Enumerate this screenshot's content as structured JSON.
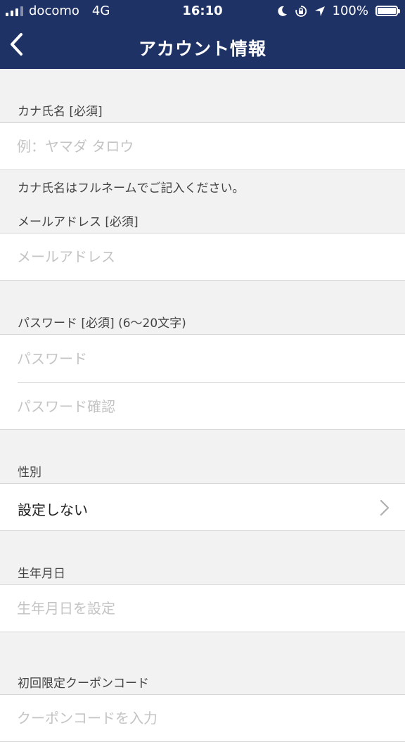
{
  "status_bar": {
    "carrier": "docomo",
    "network": "4G",
    "time": "16:10",
    "battery_text": "100%",
    "battery_level": 1.0
  },
  "nav": {
    "title": "アカウント情報",
    "back_icon": "chevron-left-icon"
  },
  "form": {
    "kana_name": {
      "label": "カナ氏名 [必須]",
      "placeholder": "例：ヤマダ タロウ",
      "hint": "カナ氏名はフルネームでご記入ください。"
    },
    "email": {
      "label": "メールアドレス [必須]",
      "placeholder": "メールアドレス"
    },
    "password": {
      "label": "パスワード [必須] (6〜20文字)",
      "placeholder": "パスワード",
      "confirm_placeholder": "パスワード確認"
    },
    "gender": {
      "label": "性別",
      "value": "設定しない"
    },
    "birthday": {
      "label": "生年月日",
      "placeholder": "生年月日を設定"
    },
    "coupon": {
      "label": "初回限定クーポンコード",
      "placeholder": "クーポンコードを入力"
    }
  },
  "colors": {
    "header_bg": "#1f3266",
    "page_bg": "#f2f2f2",
    "placeholder": "#c4c4c4"
  }
}
